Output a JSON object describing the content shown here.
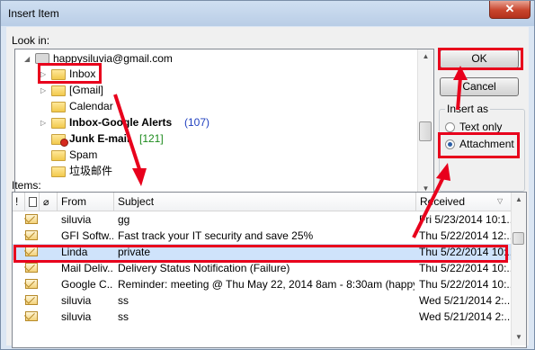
{
  "window": {
    "title": "Insert Item",
    "close_glyph": "✕"
  },
  "look_in": {
    "label": "Look in:"
  },
  "tree": [
    {
      "label": "happysiluvia@gmail.com",
      "bold": false,
      "count": ""
    },
    {
      "label": "Inbox",
      "bold": false,
      "count": ""
    },
    {
      "label": "[Gmail]",
      "bold": false,
      "count": ""
    },
    {
      "label": "Calendar",
      "bold": false,
      "count": ""
    },
    {
      "label": "Inbox-Google Alerts",
      "bold": true,
      "count": "(107)"
    },
    {
      "label": "Junk E-mail",
      "bold": true,
      "count": "[121]"
    },
    {
      "label": "Spam",
      "bold": false,
      "count": ""
    },
    {
      "label": "垃圾邮件",
      "bold": false,
      "count": ""
    }
  ],
  "buttons": {
    "ok": "OK",
    "cancel": "Cancel"
  },
  "insert_as": {
    "label": "Insert as",
    "options": [
      {
        "label": "Text only",
        "selected": false
      },
      {
        "label": "Attachment",
        "selected": true
      }
    ]
  },
  "items": {
    "label": "Items:",
    "columns": {
      "importance": "!",
      "icon": "",
      "attachment": "",
      "from": "From",
      "subject": "Subject",
      "received": "Received"
    },
    "rows": [
      {
        "from": "siluvia",
        "subject": "gg",
        "received": "Fri 5/23/2014 10:1..."
      },
      {
        "from": "GFI Softw...",
        "subject": "Fast track your IT security and save 25%",
        "received": "Thu 5/22/2014 12:..."
      },
      {
        "from": "Linda",
        "subject": "private",
        "received": "Thu 5/22/2014 10:..."
      },
      {
        "from": "Mail Deliv...",
        "subject": "Delivery Status Notification (Failure)",
        "received": "Thu 5/22/2014 10:..."
      },
      {
        "from": "Google C...",
        "subject": "Reminder: meeting @ Thu May 22, 2014 8am - 8:30am (happysil...",
        "received": "Thu 5/22/2014 10:..."
      },
      {
        "from": "siluvia",
        "subject": "ss",
        "received": "Wed 5/21/2014 2:..."
      },
      {
        "from": "siluvia",
        "subject": "ss",
        "received": "Wed 5/21/2014 2:..."
      }
    ]
  },
  "colors": {
    "highlight": "#e8001c",
    "selected_row": "#cfe3fb",
    "count_blue": "#1f3fbf",
    "count_green": "#1b8a1b"
  }
}
